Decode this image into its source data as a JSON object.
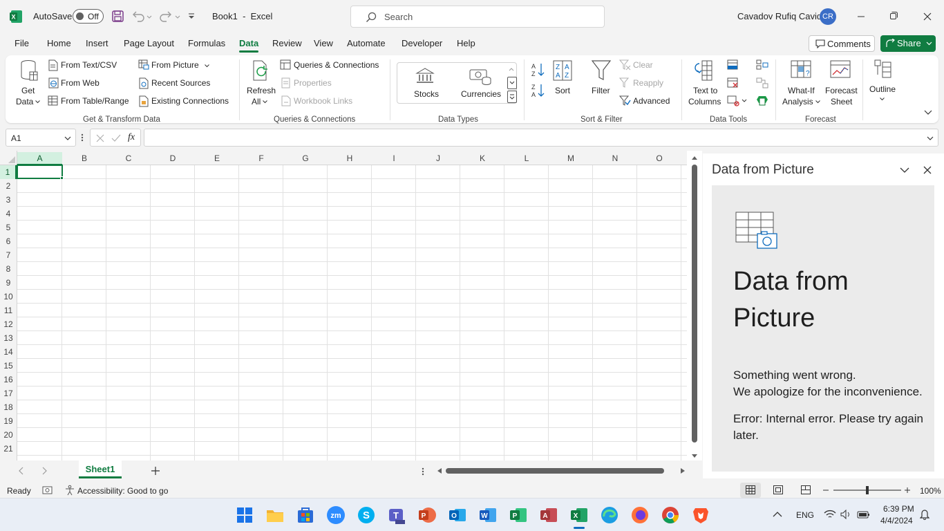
{
  "titlebar": {
    "autosave_label": "AutoSave",
    "autosave_state": "Off",
    "doc_title": "Book1  -  Excel",
    "search_placeholder": "Search",
    "user_name": "Cavadov Rufiq Cavid",
    "user_initials": "CR"
  },
  "tabs": [
    "File",
    "Home",
    "Insert",
    "Page Layout",
    "Formulas",
    "Data",
    "Review",
    "View",
    "Automate",
    "Developer",
    "Help"
  ],
  "active_tab": "Data",
  "header_buttons": {
    "comments": "Comments",
    "share": "Share"
  },
  "ribbon": {
    "get_data": [
      "Get",
      "Data"
    ],
    "from_text_csv": "From Text/CSV",
    "from_web": "From Web",
    "from_table_range": "From Table/Range",
    "from_picture": "From Picture",
    "recent_sources": "Recent Sources",
    "existing_connections": "Existing Connections",
    "group_get_transform": "Get & Transform Data",
    "refresh_all": [
      "Refresh",
      "All"
    ],
    "queries_connections": "Queries & Connections",
    "properties": "Properties",
    "workbook_links": "Workbook Links",
    "group_queries": "Queries & Connections",
    "stocks": "Stocks",
    "currencies": "Currencies",
    "group_data_types": "Data Types",
    "sort": "Sort",
    "filter": "Filter",
    "clear": "Clear",
    "reapply": "Reapply",
    "advanced": "Advanced",
    "group_sort_filter": "Sort & Filter",
    "text_to_columns": [
      "Text to",
      "Columns"
    ],
    "group_data_tools": "Data Tools",
    "what_if": [
      "What-If",
      "Analysis"
    ],
    "forecast_sheet": [
      "Forecast",
      "Sheet"
    ],
    "group_forecast": "Forecast",
    "outline": "Outline"
  },
  "formula_bar": {
    "name_box": "A1",
    "fx": "fx",
    "formula": ""
  },
  "grid": {
    "columns": [
      "A",
      "B",
      "C",
      "D",
      "E",
      "F",
      "G",
      "H",
      "I",
      "J",
      "K",
      "L",
      "M",
      "N",
      "O"
    ],
    "rows": [
      "1",
      "2",
      "3",
      "4",
      "5",
      "6",
      "7",
      "8",
      "9",
      "10",
      "11",
      "12",
      "13",
      "14",
      "15",
      "16",
      "17",
      "18",
      "19",
      "20",
      "21"
    ],
    "selected_cell": "A1"
  },
  "pane": {
    "header_title": "Data from Picture",
    "big_title_line1": "Data from",
    "big_title_line2": "Picture",
    "msg1": "Something went wrong.",
    "msg2": "We apologize for the inconvenience.",
    "err1": "Error: Internal error. Please try again",
    "err2": "later."
  },
  "sheets": {
    "active": "Sheet1"
  },
  "status": {
    "ready": "Ready",
    "accessibility": "Accessibility: Good to go",
    "zoom": "100%"
  },
  "taskbar": {
    "lang": "ENG",
    "time": "6:39 PM",
    "date": "4/4/2024"
  },
  "colors": {
    "excel_green": "#107c41",
    "accent_blue": "#0f6cbd"
  }
}
